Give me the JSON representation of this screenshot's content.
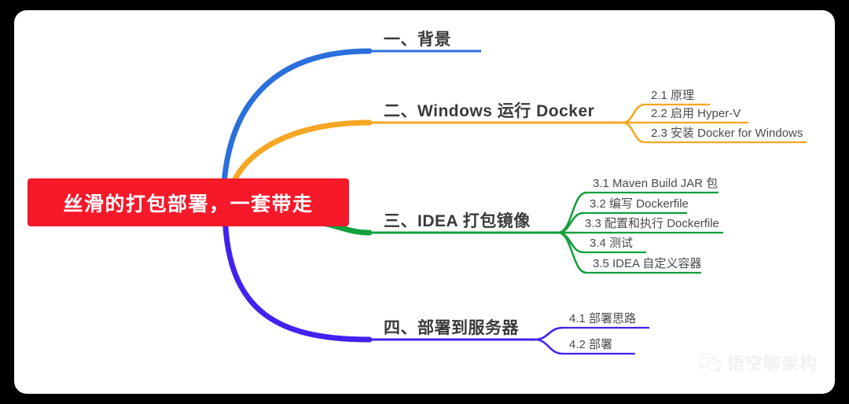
{
  "canvas": {
    "background": "#ffffff",
    "outer_background": "#000000"
  },
  "center": {
    "label": "丝滑的打包部署，一套带走",
    "color": "#f5192a",
    "text_color": "#ffffff"
  },
  "branches": [
    {
      "id": "branch-1",
      "title": "一、背景",
      "color": "#2b6fdd",
      "children": []
    },
    {
      "id": "branch-2",
      "title": "二、Windows 运行 Docker",
      "color": "#f5a623",
      "children": [
        {
          "id": "item-2-1",
          "label": "2.1 原理"
        },
        {
          "id": "item-2-2",
          "label": "2.2 启用 Hyper-V"
        },
        {
          "id": "item-2-3",
          "label": "2.3 安装 Docker for Windows"
        }
      ]
    },
    {
      "id": "branch-3",
      "title": "三、IDEA 打包镜像",
      "color": "#12a03c",
      "children": [
        {
          "id": "item-3-1",
          "label": "3.1 Maven Build JAR 包"
        },
        {
          "id": "item-3-2",
          "label": "3.2 编写 Dockerfile"
        },
        {
          "id": "item-3-3",
          "label": "3.3 配置和执行 Dockerfile"
        },
        {
          "id": "item-3-4",
          "label": "3.4 测试"
        },
        {
          "id": "item-3-5",
          "label": "3.5 IDEA 自定义容器"
        }
      ]
    },
    {
      "id": "branch-4",
      "title": "四、部署到服务器",
      "color": "#4322ee",
      "children": [
        {
          "id": "item-4-1",
          "label": "4.1 部署思路"
        },
        {
          "id": "item-4-2",
          "label": "4.2 部署"
        }
      ]
    }
  ],
  "watermark": {
    "text": "悟空聊架构",
    "icon": "wechat-icon",
    "color": "#f0f0f0"
  }
}
